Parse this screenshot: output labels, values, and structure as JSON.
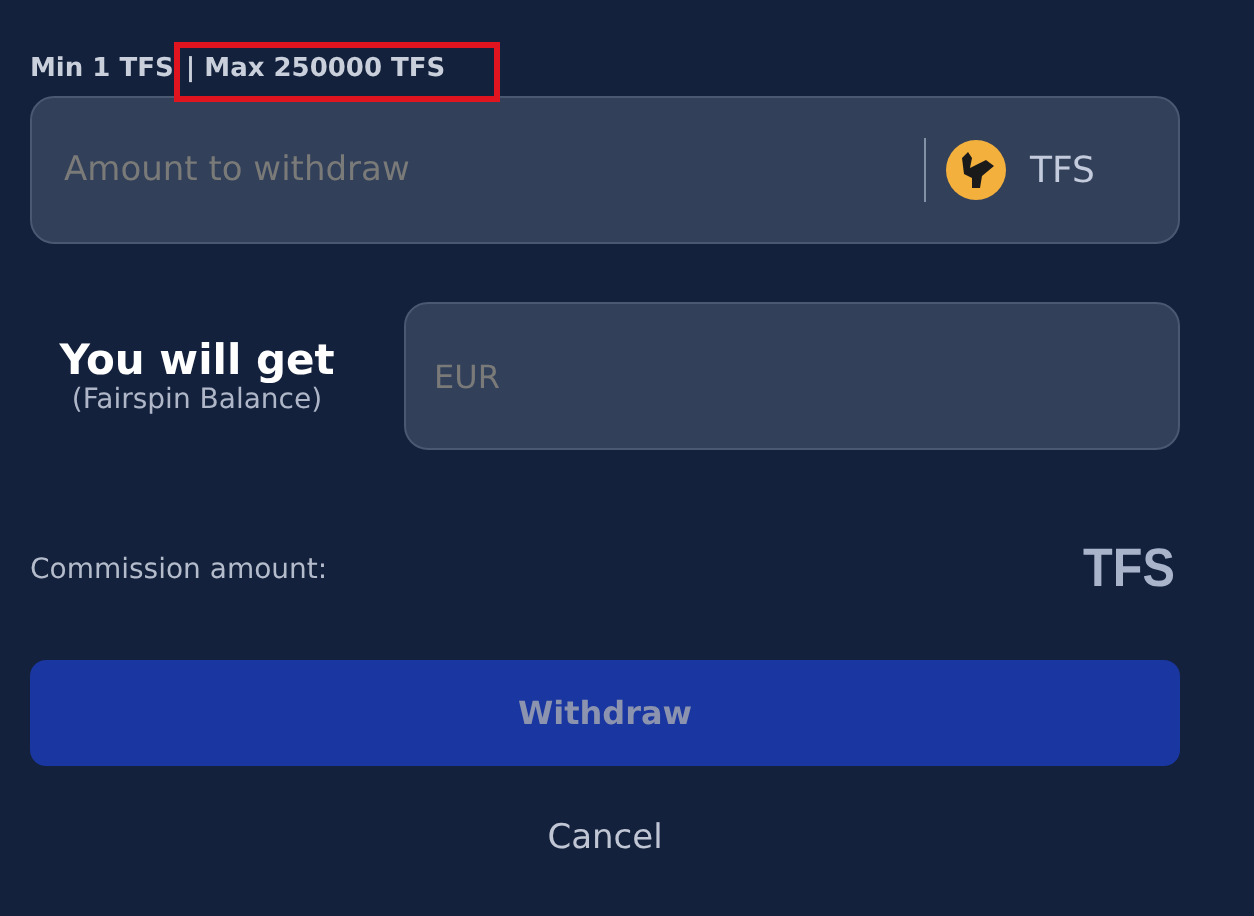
{
  "limits": [
    {
      "text": "Min 1 TFS",
      "highlighted": false
    },
    {
      "text": "| Max 250000 TFS",
      "highlighted": true
    }
  ],
  "amount_field": {
    "placeholder": "Amount to withdraw",
    "currency": "TFS"
  },
  "receive": {
    "label": "You will get",
    "sublabel": "(Fairspin Balance)",
    "placeholder": "EUR"
  },
  "commission": {
    "label": "Commission amount:",
    "value": "TFS"
  },
  "withdraw_button": {
    "label": "Withdraw",
    "disabled": true
  },
  "cancel_link": "Cancel"
}
